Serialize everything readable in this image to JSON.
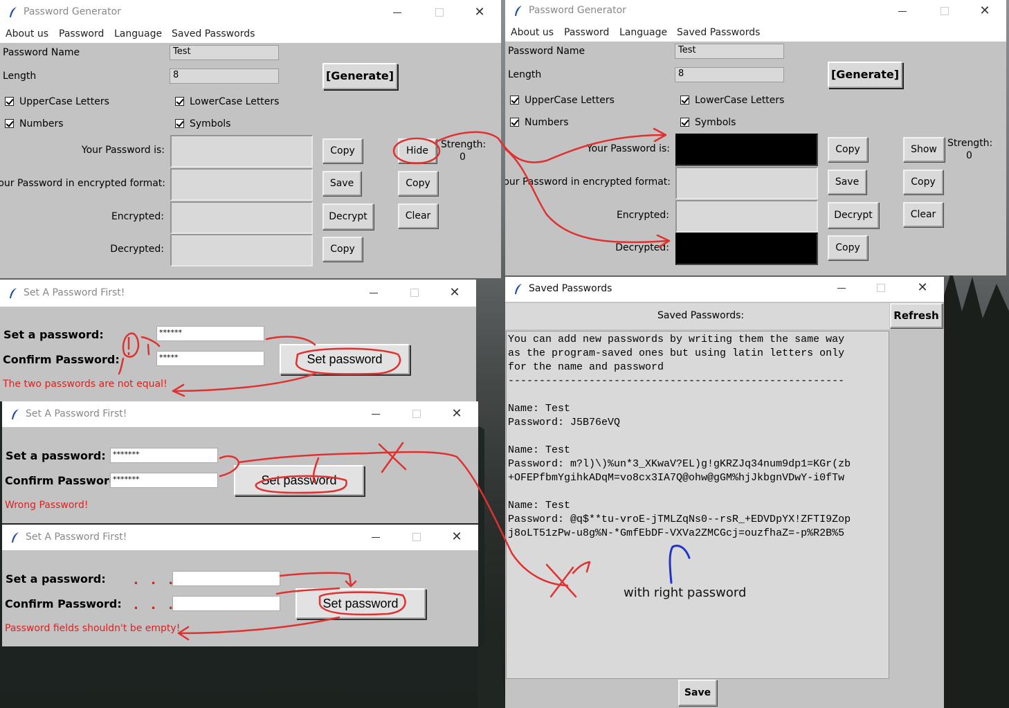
{
  "gen_window": {
    "title": "Password Generator",
    "menu": [
      "About us",
      "Password",
      "Language",
      "Saved Passwords"
    ],
    "password_name_label": "Password Name",
    "password_name_value": "Test",
    "length_label": "Length",
    "length_value": "8",
    "generate_label": "[Generate]",
    "checks": [
      "UpperCase Letters",
      "LowerCase Letters",
      "Numbers",
      "Symbols"
    ],
    "your_password_label": "Your Password is:",
    "encrypted_format_label": "Your Password in encrypted format:",
    "encrypted_label": "Encrypted:",
    "decrypted_label": "Decrypted:",
    "copy_label": "Copy",
    "save_label": "Save",
    "decrypt_label": "Decrypt",
    "clear_label": "Clear",
    "hide_label": "Hide",
    "show_label": "Show",
    "strength_label": "Strength:",
    "strength_value": "0"
  },
  "set_password_dialogs": [
    {
      "title": "Set A Password First!",
      "set_label": "Set a password:",
      "confirm_label": "Confirm Password:",
      "set_value": "******",
      "confirm_value": "*****",
      "button": "Set password",
      "error": "The two passwords are not equal!"
    },
    {
      "title": "Set A Password First!",
      "set_label": "Set a password:",
      "confirm_label": "Confirm Password:",
      "set_value": "*******",
      "confirm_value": "*******",
      "button": "Set password",
      "error": "Wrong Password!"
    },
    {
      "title": "Set A Password First!",
      "set_label": "Set a password:",
      "confirm_label": "Confirm Password:",
      "set_value": "",
      "confirm_value": "",
      "button": "Set password",
      "error": "Password fields shouldn't be empty!",
      "dots": ". . ."
    }
  ],
  "saved_window": {
    "title": "Saved Passwords",
    "header": "Saved Passwords:",
    "refresh_label": "Refresh",
    "save_label": "Save",
    "text": "You can add new passwords by writing them the same way\nas the program-saved ones but using latin letters only\nfor the name and password\n------------------------------------------------------\n\nName: Test\nPassword: J5B76eVQ\n\nName: Test\nPassword: m?l)\\)%un*3_XKwaV?EL)g!gKRZJq34num9dp1=KGr(zb\n+OFEPfbmYgihkADqM=vo8cx3IA7Q@ohw@gGM%hjJkbgnVDwY-i0fTw\n\nName: Test\nPassword: @q$**tu-vroE-jTMLZqNs0--rsR_+EDVDpYX!ZFTI9Zop\nj8oLT51zPw-u8g%N-*GmfEbDF-VXVa2ZMCGcj=ouzfhaZ=-p%R2B%5"
  },
  "annotation": {
    "note": "with right password"
  },
  "colors": {
    "window_bg": "#c3c3c3",
    "field_bg": "#d9d9d9",
    "error": "#e02020",
    "annotation_red": "#e03030",
    "annotation_blue": "#2233cc"
  }
}
